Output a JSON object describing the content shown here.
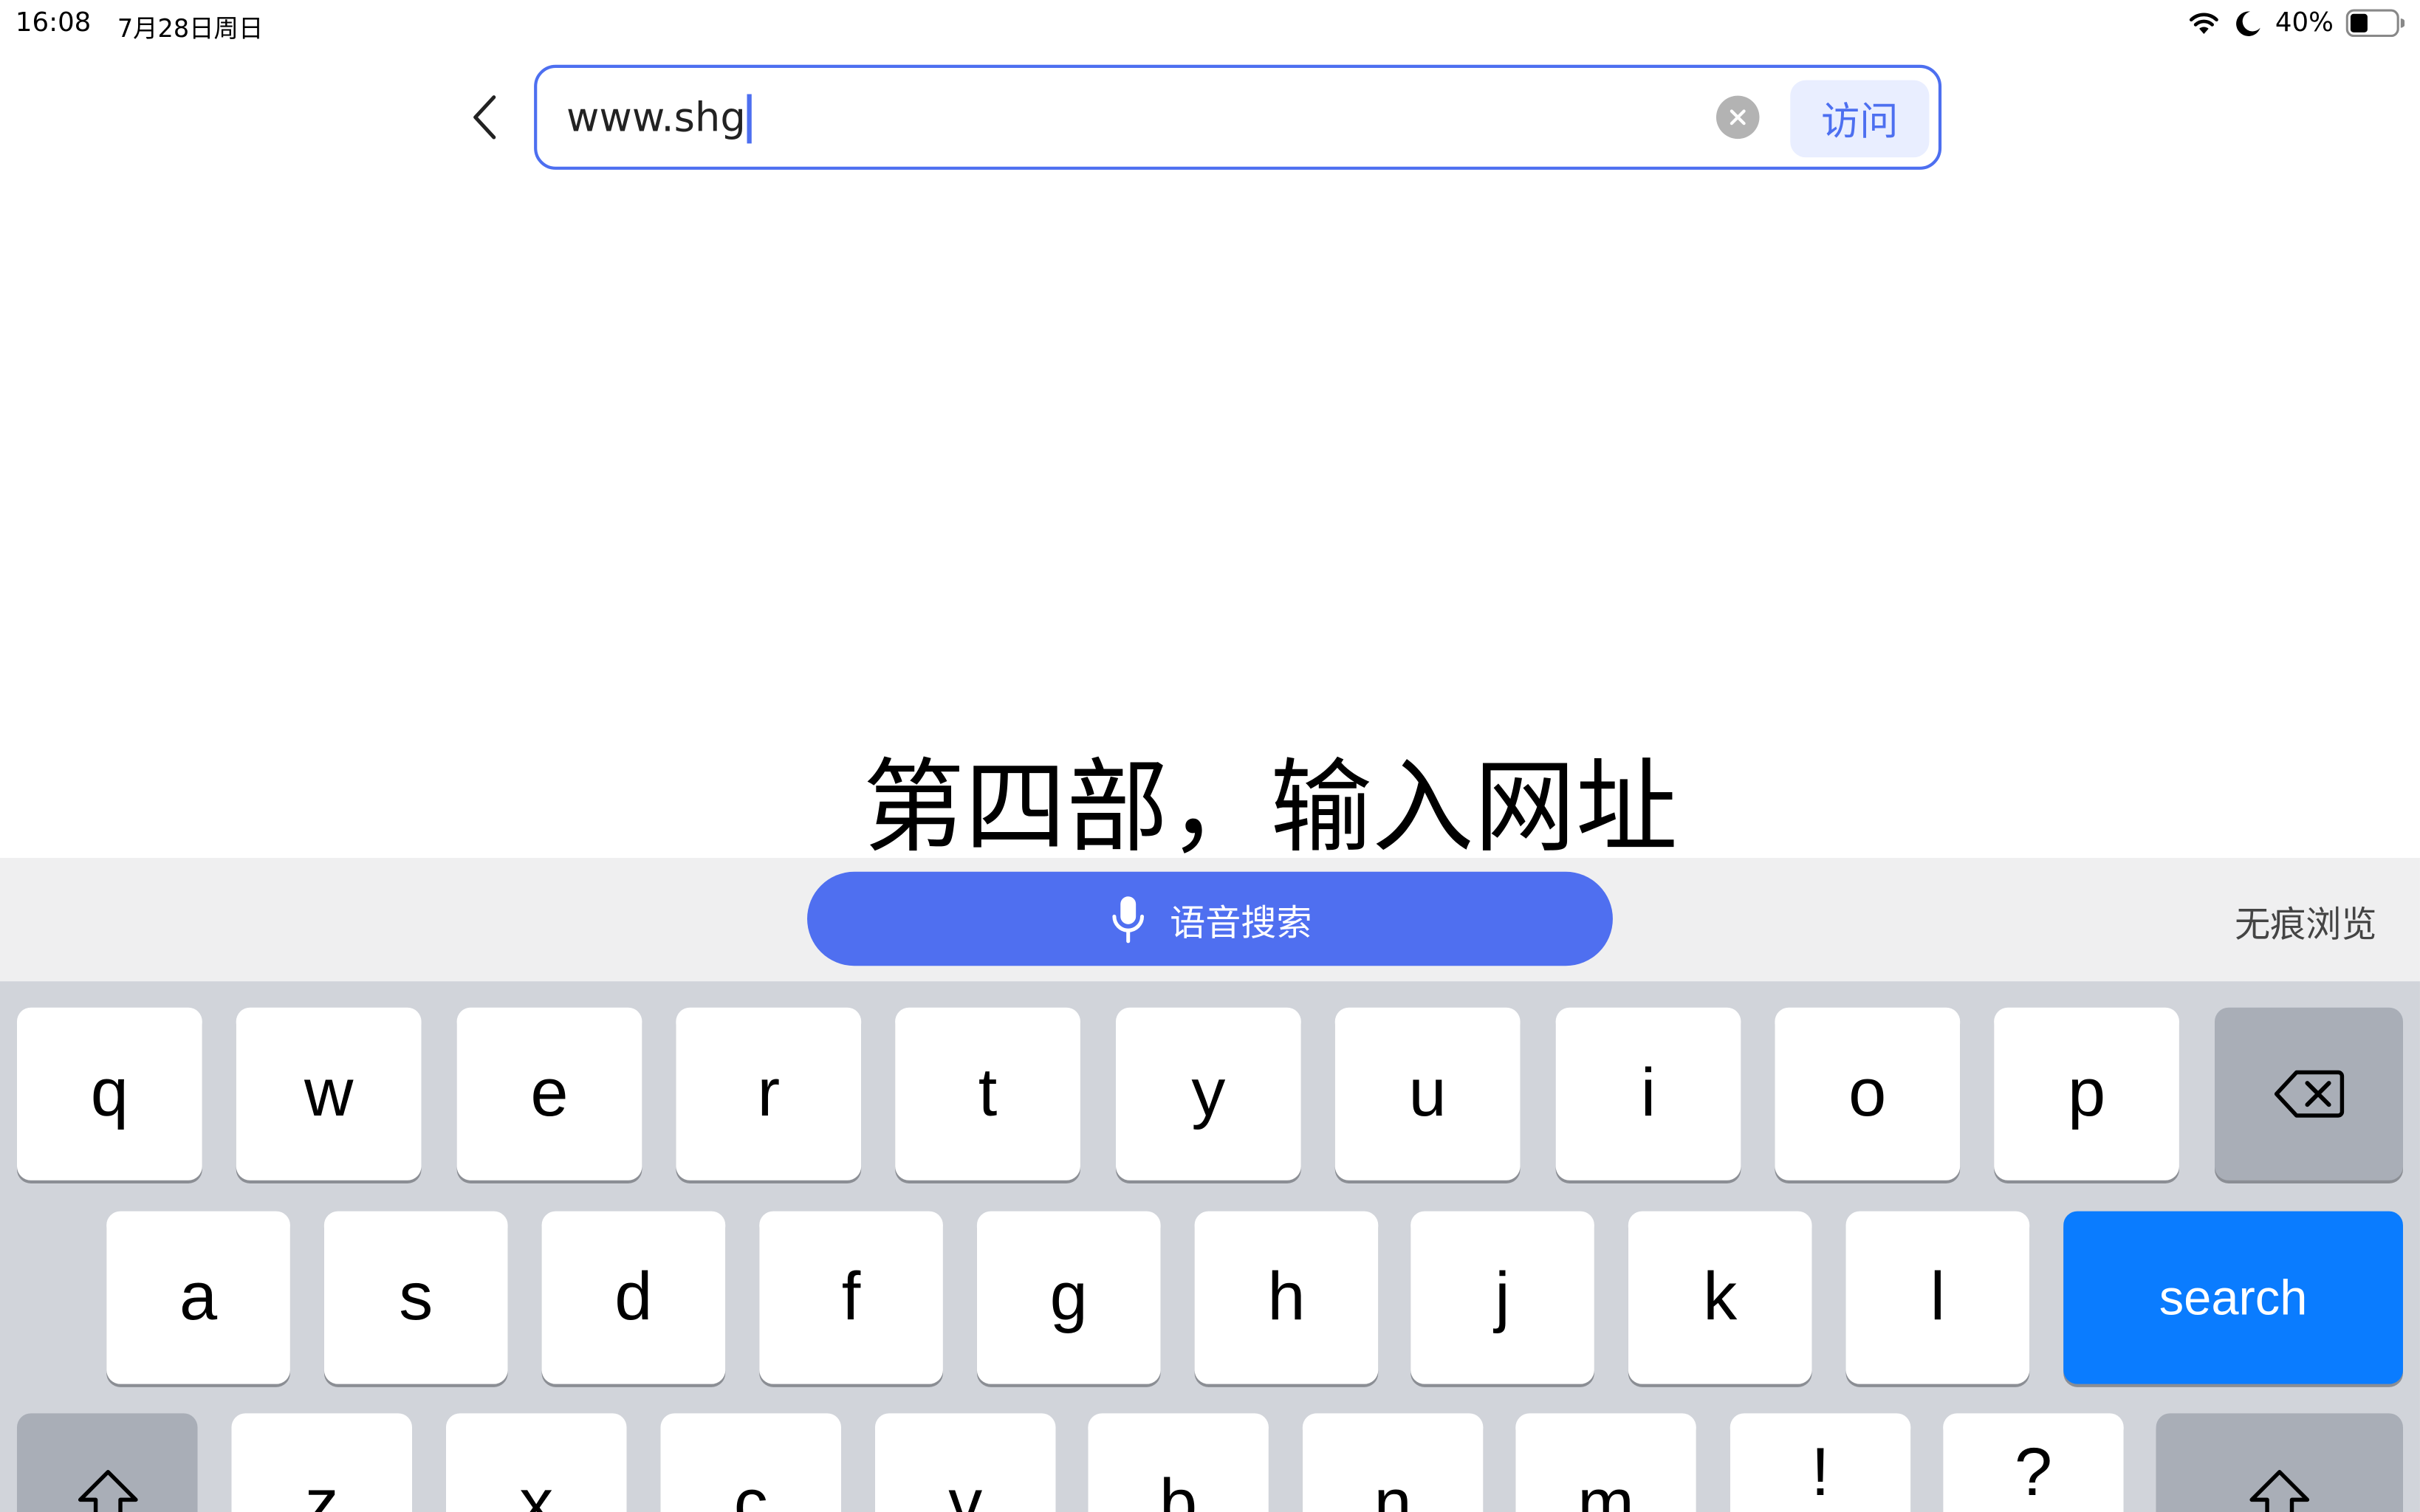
{
  "status_bar": {
    "time": "16:08",
    "date": "7月28日周日",
    "battery": "40%"
  },
  "address_bar": {
    "url_value": "www.shg",
    "visit_label": "访问"
  },
  "caption": "第四部，输入网址",
  "suggestion_bar": {
    "voice_search_label": "语音搜索",
    "incognito_label": "无痕浏览"
  },
  "keyboard": {
    "row1": [
      "q",
      "w",
      "e",
      "r",
      "t",
      "y",
      "u",
      "i",
      "o",
      "p"
    ],
    "row2": [
      "a",
      "s",
      "d",
      "f",
      "g",
      "h",
      "j",
      "k",
      "l"
    ],
    "search_label": "search",
    "row3": [
      "z",
      "x",
      "c",
      "v",
      "b",
      "n",
      "m",
      "!",
      "?"
    ]
  },
  "colors": {
    "accent": "#4d6ff0",
    "search_key": "#0a7cff",
    "keyboard_bg": "#d1d4da"
  }
}
